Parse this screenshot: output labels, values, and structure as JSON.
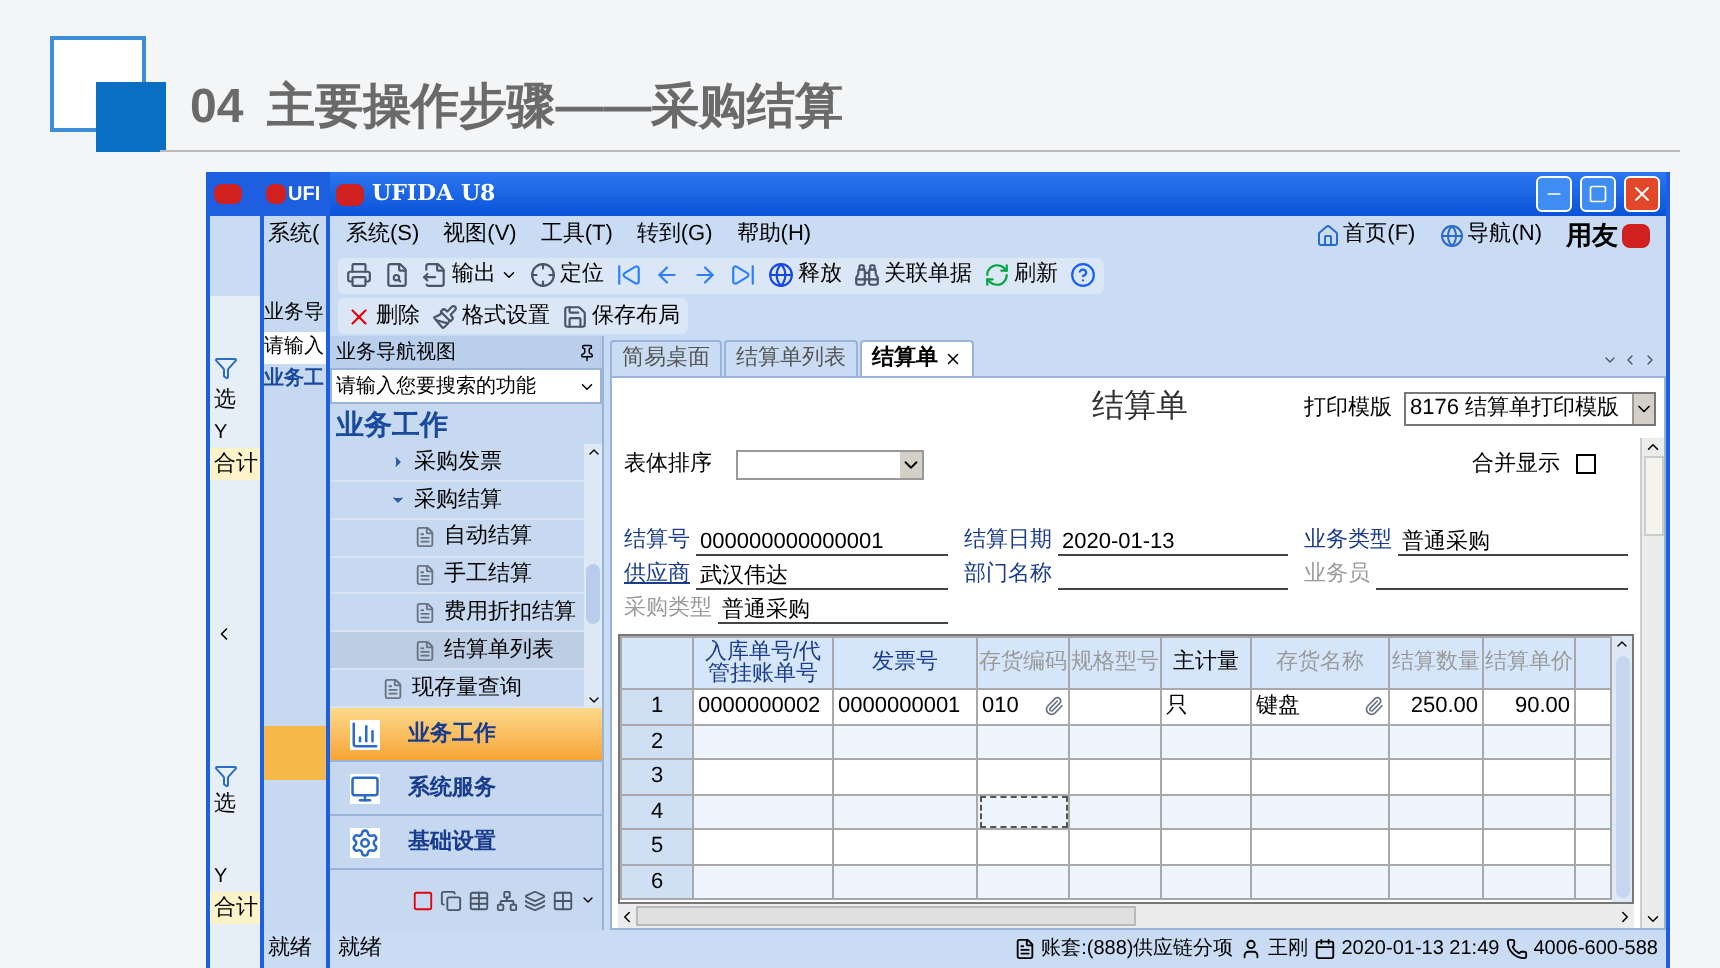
{
  "slide": {
    "number": "04",
    "title": "主要操作步骤——采购结算"
  },
  "back_window_1": {
    "texts": [
      "选",
      "Y",
      "合计",
      "选",
      "Y",
      "合计"
    ]
  },
  "back_window_2": {
    "title": "UFI",
    "menu": "系统(",
    "nav_header": "业务导",
    "search": "请输入",
    "section": "业务工",
    "status": "就绪"
  },
  "window": {
    "title": "UFIDA U8",
    "menu": [
      "系统(S)",
      "视图(V)",
      "工具(T)",
      "转到(G)",
      "帮助(H)"
    ],
    "menu_right": [
      {
        "label": "首页(F)",
        "kind": "home"
      },
      {
        "label": "导航(N)",
        "kind": "globe"
      }
    ],
    "brand": "用友",
    "toolbar": [
      {
        "kind": "print"
      },
      {
        "kind": "preview"
      },
      {
        "kind": "export",
        "label": "输出"
      },
      {
        "kind": "locate",
        "label": "定位"
      },
      {
        "kind": "first"
      },
      {
        "kind": "prev"
      },
      {
        "kind": "next"
      },
      {
        "kind": "last"
      },
      {
        "kind": "release",
        "label": "释放"
      },
      {
        "kind": "related",
        "label": "关联单据"
      },
      {
        "kind": "refresh",
        "label": "刷新"
      },
      {
        "kind": "help"
      }
    ],
    "toolbar2": [
      {
        "kind": "delete",
        "label": "删除"
      },
      {
        "kind": "format",
        "label": "格式设置"
      },
      {
        "kind": "save",
        "label": "保存布局"
      }
    ]
  },
  "nav": {
    "header": "业务导航视图",
    "search": {
      "placeholder": "请输入您要搜索的功能"
    },
    "section_title": "业务工作",
    "tree": [
      {
        "label": "采购发票",
        "expanded": false,
        "selected": false
      },
      {
        "label": "采购结算",
        "expanded": true,
        "selected": false,
        "children": [
          {
            "label": "自动结算",
            "selected": false
          },
          {
            "label": "手工结算",
            "selected": false
          },
          {
            "label": "费用折扣结算",
            "selected": false
          },
          {
            "label": "结算单列表",
            "selected": true
          }
        ]
      },
      {
        "label": "现存量查询",
        "selected": false
      }
    ],
    "sections": [
      {
        "label": "业务工作",
        "kind": "work",
        "selected": true
      },
      {
        "label": "系统服务",
        "kind": "system",
        "selected": false
      },
      {
        "label": "基础设置",
        "kind": "settings",
        "selected": false
      }
    ]
  },
  "tabs": [
    {
      "label": "简易桌面",
      "selected": false
    },
    {
      "label": "结算单列表",
      "selected": false
    },
    {
      "label": "结算单",
      "selected": true
    }
  ],
  "document": {
    "title": "结算单",
    "print_template": {
      "label": "打印模版",
      "value": "8176 结算单打印模版"
    },
    "sort": {
      "label": "表体排序"
    },
    "merge": {
      "label": "合并显示",
      "checked": false
    },
    "fields": [
      {
        "label": "结算号",
        "value": "000000000000001",
        "kind": "required"
      },
      {
        "label": "结算日期",
        "value": "2020-01-13",
        "kind": "required"
      },
      {
        "label": "业务类型",
        "value": "普通采购",
        "kind": "required"
      },
      {
        "label": "供应商",
        "value": "武汉伟达",
        "kind": "link"
      },
      {
        "label": "部门名称",
        "kind": "required"
      },
      {
        "label": "业务员",
        "kind": "optional"
      },
      {
        "label": "采购类型",
        "value": "普通采购",
        "kind": "optional"
      }
    ],
    "columns": [
      {
        "label": "入库单号/代管挂账单号",
        "kind": "required",
        "numeric": false
      },
      {
        "label": "发票号",
        "kind": "required",
        "numeric": false
      },
      {
        "label": "存货编码",
        "kind": "readonly",
        "numeric": false
      },
      {
        "label": "规格型号",
        "kind": "readonly",
        "numeric": false
      },
      {
        "label": "主计量",
        "kind": "editable",
        "numeric": false
      },
      {
        "label": "存货名称",
        "kind": "readonly",
        "numeric": false
      },
      {
        "label": "结算数量",
        "kind": "readonly",
        "numeric": true
      },
      {
        "label": "结算单价",
        "kind": "readonly",
        "numeric": true
      }
    ],
    "rows": [
      {
        "number": "1",
        "cells": [
          {
            "text": "0000000002",
            "attachment": false
          },
          {
            "text": "0000000001",
            "attachment": false
          },
          {
            "text": "010",
            "attachment": true
          },
          {
            "attachment": false
          },
          {
            "text": "只",
            "attachment": false
          },
          {
            "text": "键盘",
            "attachment": true
          },
          {
            "text": "250.00",
            "attachment": false
          },
          {
            "text": "90.00",
            "attachment": false
          }
        ]
      },
      {
        "number": "2"
      },
      {
        "number": "3"
      },
      {
        "number": "4",
        "cells": [
          {
            "focused": false
          },
          {
            "focused": false
          },
          {
            "focused": true
          },
          {
            "focused": false
          },
          {
            "focused": false
          },
          {
            "focused": false
          },
          {
            "focused": false
          },
          {
            "focused": false
          }
        ]
      },
      {
        "number": "5"
      },
      {
        "number": "6"
      }
    ]
  },
  "status_bar": {
    "left": "就绪",
    "account": "账套:(888)供应链分项",
    "user": "王刚",
    "datetime": "2020-01-13 21:49",
    "phone": "4006-600-588"
  }
}
